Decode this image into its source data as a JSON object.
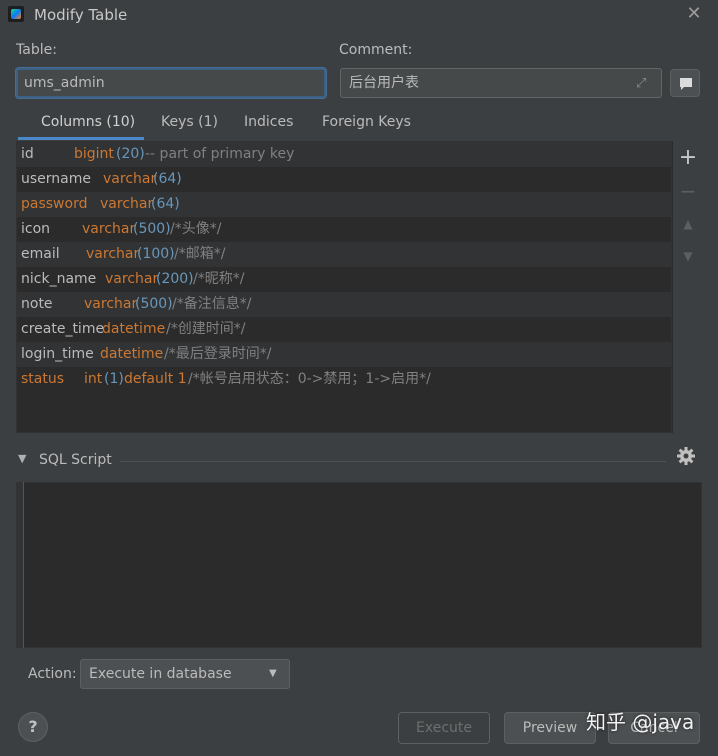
{
  "window": {
    "title": "Modify Table"
  },
  "table_label": "Table:",
  "table_value": "ums_admin",
  "comment_label": "Comment:",
  "comment_value": "后台用户表",
  "tabs": [
    {
      "label": "Columns (10)",
      "active": true
    },
    {
      "label": "Keys (1)",
      "active": false
    },
    {
      "label": "Indices",
      "active": false
    },
    {
      "label": "Foreign Keys",
      "active": false
    }
  ],
  "columns": [
    {
      "name": "id",
      "type": "bigint",
      "size": "(20)",
      "extra": "",
      "comment": "-- part of primary key"
    },
    {
      "name": "username",
      "type": "varchar",
      "size": "(64)",
      "extra": "",
      "comment": ""
    },
    {
      "name": "password",
      "type": "varchar",
      "size": "(64)",
      "extra": "",
      "comment": ""
    },
    {
      "name": "icon",
      "type": "varchar",
      "size": "(500)",
      "extra": "",
      "comment": "/*头像*/"
    },
    {
      "name": "email",
      "type": "varchar",
      "size": "(100)",
      "extra": "",
      "comment": "/*邮箱*/"
    },
    {
      "name": "nick_name",
      "type": "varchar",
      "size": "(200)",
      "extra": "",
      "comment": "/*昵称*/"
    },
    {
      "name": "note",
      "type": "varchar",
      "size": "(500)",
      "extra": "",
      "comment": "/*备注信息*/"
    },
    {
      "name": "create_time",
      "type": "datetime",
      "size": "",
      "extra": "",
      "comment": "/*创建时间*/"
    },
    {
      "name": "login_time",
      "type": "datetime",
      "size": "",
      "extra": "",
      "comment": "/*最后登录时间*/"
    },
    {
      "name": "status",
      "type": "int",
      "size": "(1)",
      "extra": "default 1",
      "comment": "/*帐号启用状态：0->禁用；1->启用*/"
    }
  ],
  "side_toolbar": {
    "add": "+",
    "remove": "−",
    "up": "▲",
    "down": "▼"
  },
  "sql_section": {
    "label": "SQL Script",
    "collapse_glyph": "▼",
    "content": ""
  },
  "action": {
    "label": "Action:",
    "selected": "Execute in database"
  },
  "buttons": {
    "help": "?",
    "execute": "Execute",
    "preview": "Preview",
    "cancel": "Cancel"
  },
  "watermark": "知乎 @java",
  "colors": {
    "background": "#3c3f41",
    "editor_bg": "#2b2b2b",
    "keyword": "#cc7832",
    "number": "#6897bb",
    "comment": "#808080",
    "accent": "#4a88c7"
  }
}
